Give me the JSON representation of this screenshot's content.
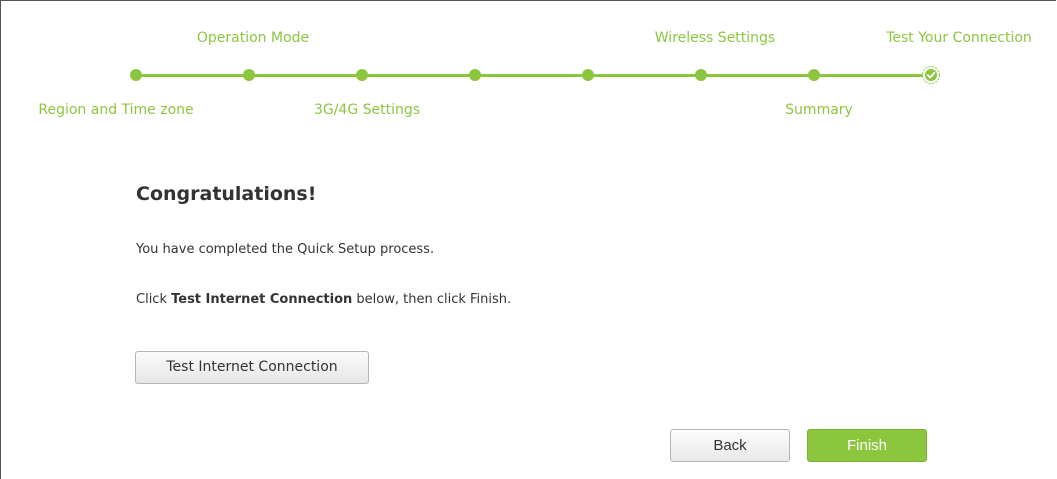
{
  "wizard": {
    "top_labels": {
      "operation_mode": "Operation Mode",
      "wireless_settings": "Wireless Settings",
      "test_connection": "Test Your Connection"
    },
    "bottom_labels": {
      "region_time_zone": "Region and Time zone",
      "settings_3g4g": "3G/4G Settings",
      "summary": "Summary"
    },
    "current_step": 8,
    "total_steps": 8,
    "accent_color": "#8cc63f"
  },
  "content": {
    "heading": "Congratulations!",
    "completed_text": "You have completed the Quick Setup process.",
    "instruction_prefix": "Click ",
    "instruction_bold": "Test Internet Connection",
    "instruction_suffix": " below, then click Finish."
  },
  "buttons": {
    "test_connection": "Test Internet Connection",
    "back": "Back",
    "finish": "Finish"
  },
  "icons": {
    "completed_step": "check-circle-icon"
  }
}
